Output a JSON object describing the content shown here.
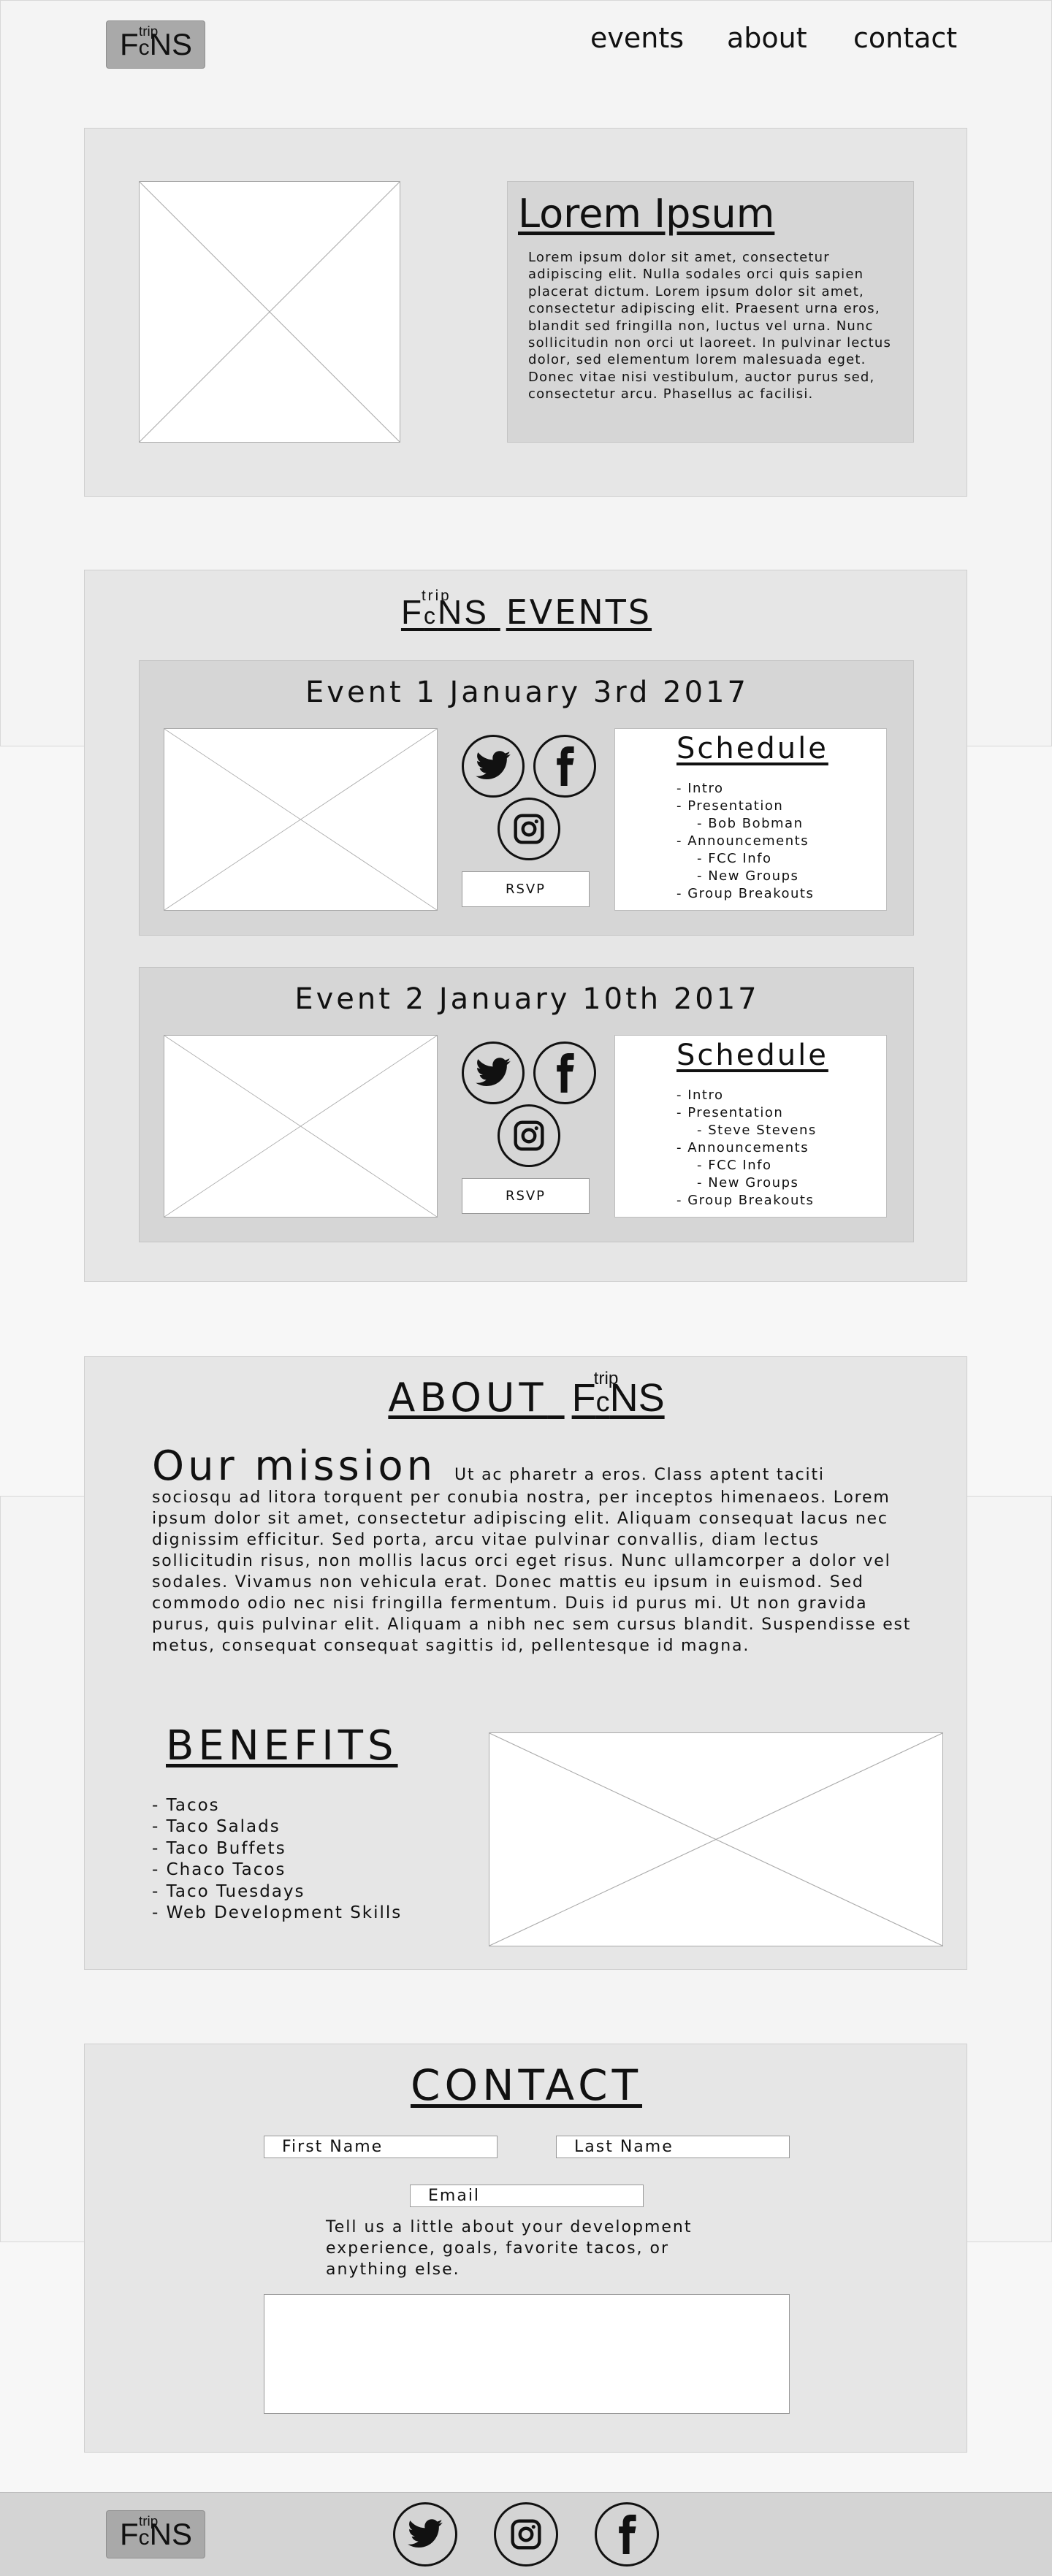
{
  "brand": {
    "main_left": "F",
    "sub": "c",
    "main_right": "NS",
    "sup": "trip"
  },
  "nav": [
    "events",
    "about",
    "contact"
  ],
  "hero": {
    "title": "Lorem Ipsum",
    "body": "Lorem ipsum dolor sit amet, consectetur adipiscing elit. Nulla sodales orci quis sapien placerat dictum. Lorem ipsum dolor sit amet, consectetur adipiscing elit. Praesent urna eros, blandit sed fringilla non, luctus vel urna. Nunc sollicitudin non orci ut laoreet. In pulvinar lectus dolor, sed elementum lorem malesuada eget. Donec vitae nisi vestibulum, auctor purus sed, consectetur arcu. Phasellus ac facilisi."
  },
  "events": {
    "title_suffix": "EVENTS",
    "items": [
      {
        "title": "Event 1 January 3rd 2017",
        "rsvp": "RSVP",
        "schedule_title": "Schedule",
        "schedule": [
          "- Intro",
          "- Presentation",
          "- Bob Bobman",
          "- Announcements",
          "- FCC Info",
          "- New Groups",
          "- Group Breakouts"
        ]
      },
      {
        "title": "Event 2 January 10th 2017",
        "rsvp": "RSVP",
        "schedule_title": "Schedule",
        "schedule": [
          "- Intro",
          "- Presentation",
          "- Steve Stevens",
          "- Announcements",
          "- FCC Info",
          "- New Groups",
          "- Group Breakouts"
        ]
      }
    ]
  },
  "about": {
    "title_prefix": "ABOUT",
    "mission_heading": "Our mission",
    "mission_first": "Ut ac pharetr a eros. Class aptent taciti",
    "mission_rest": "sociosqu ad litora torquent per conubia nostra, per inceptos himenaeos. Lorem ipsum dolor sit amet, consectetur adipiscing elit. Aliquam consequat lacus nec dignissim efficitur. Sed porta, arcu vitae pulvinar convallis, diam lectus sollicitudin risus, non mollis lacus orci eget risus. Nunc ullamcorper a dolor vel sodales. Vivamus non vehicula erat. Donec mattis eu ipsum in euismod. Sed commodo odio nec nisi fringilla fermentum. Duis id purus mi. Ut non gravida purus, quis pulvinar elit. Aliquam a nibh nec sem cursus blandit. Suspendisse est metus, consequat consequat sagittis id, pellentesque id magna.",
    "benefits_title": "BENEFITS",
    "benefits": [
      "- Tacos",
      "- Taco Salads",
      "- Taco Buffets",
      "- Chaco Tacos",
      "- Taco Tuesdays",
      "- Web Development Skills"
    ]
  },
  "contact": {
    "title": "CONTACT",
    "first_name": "First Name",
    "last_name": "Last Name",
    "email": "Email",
    "prompt": "Tell us a little about your development experience, goals, favorite tacos, or anything else."
  },
  "icons": [
    "twitter-icon",
    "facebook-icon",
    "instagram-icon"
  ]
}
